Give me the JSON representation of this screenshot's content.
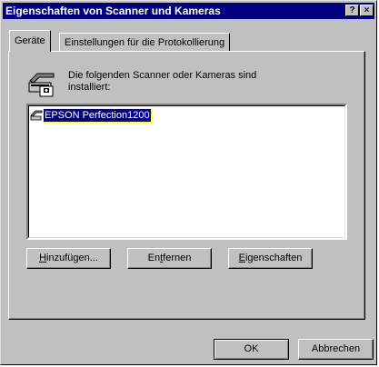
{
  "window": {
    "title": "Eigenschaften von Scanner und Kameras",
    "help_button": "?",
    "close_button": "×"
  },
  "tabs": [
    {
      "label": "Geräte",
      "active": true
    },
    {
      "label": "Einstellungen für die Protokollierung",
      "active": false
    }
  ],
  "info": {
    "icon": "scanner-camera-icon",
    "line1": "Die folgenden Scanner oder Kameras sind",
    "line2": "installiert:"
  },
  "devices": [
    {
      "label": "EPSON Perfection1200",
      "icon": "scanner-device-icon",
      "selected": true
    }
  ],
  "buttons": {
    "add": {
      "pre": "",
      "key": "H",
      "post": "inzufügen..."
    },
    "remove": {
      "pre": "En",
      "key": "t",
      "post": "fernen"
    },
    "properties": {
      "pre": "",
      "key": "E",
      "post": "igenschaften"
    }
  },
  "footer": {
    "ok": "OK",
    "cancel": "Abbrechen"
  }
}
